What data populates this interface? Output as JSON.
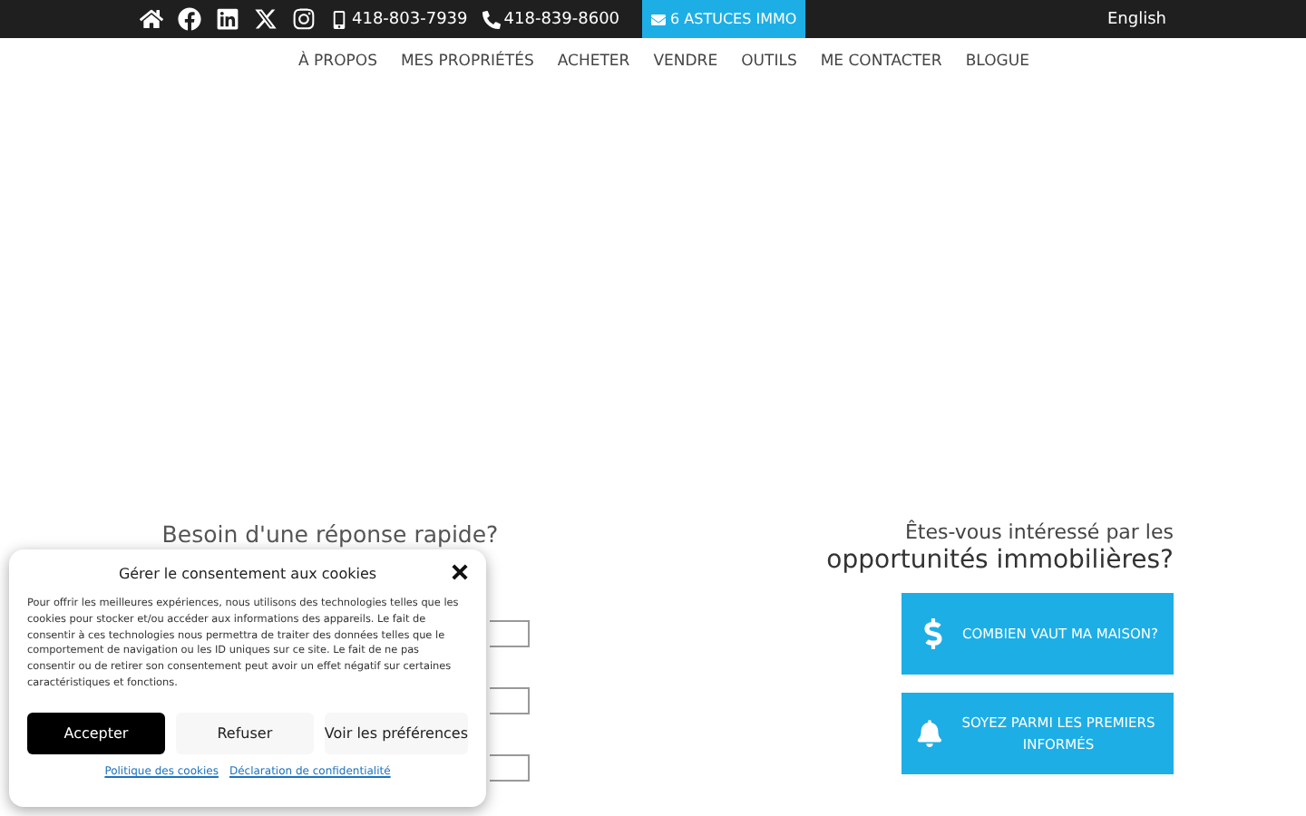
{
  "top_bar": {
    "phones": [
      "418-803-7939",
      "418-839-8600"
    ],
    "promo": "6 ASTUCES IMMO",
    "language": "English"
  },
  "nav": [
    "À PROPOS",
    "MES PROPRIÉTÉS",
    "ACHETER",
    "VENDRE",
    "OUTILS",
    "ME CONTACTER",
    "BLOGUE"
  ],
  "contact": {
    "heading": "Besoin d'une réponse rapide?",
    "fields": [
      {
        "kind": "text"
      },
      {
        "kind": "text"
      },
      {
        "kind": "text"
      }
    ]
  },
  "opportunities": {
    "line_1": "Êtes-vous intéressé par les",
    "line_2": "opportunités immobilières?",
    "buttons": [
      {
        "kind": "dollar",
        "label": "COMBIEN VAUT MA MAISON?"
      },
      {
        "kind": "bell",
        "label": "SOYEZ PARMI LES PREMIERS INFORMÉS"
      }
    ]
  },
  "cookie_dialog": {
    "title": "Gérer le consentement aux cookies",
    "body": "Pour offrir les meilleures expériences, nous utilisons des technologies telles que les cookies pour stocker et/ou accéder aux informations des appareils. Le fait de consentir à ces technologies nous permettra de traiter des données telles que le comportement de navigation ou les ID uniques sur ce site. Le fait de ne pas consentir ou de retirer son consentement peut avoir un effet négatif sur certaines caractéristiques et fonctions.",
    "buttons": [
      {
        "label": "Accepter",
        "primary": true
      },
      {
        "label": "Refuser",
        "primary": false
      },
      {
        "label": "Voir les préférences",
        "primary": false
      }
    ],
    "links": [
      "Politique des cookies",
      "Déclaration de confidentialité"
    ]
  }
}
